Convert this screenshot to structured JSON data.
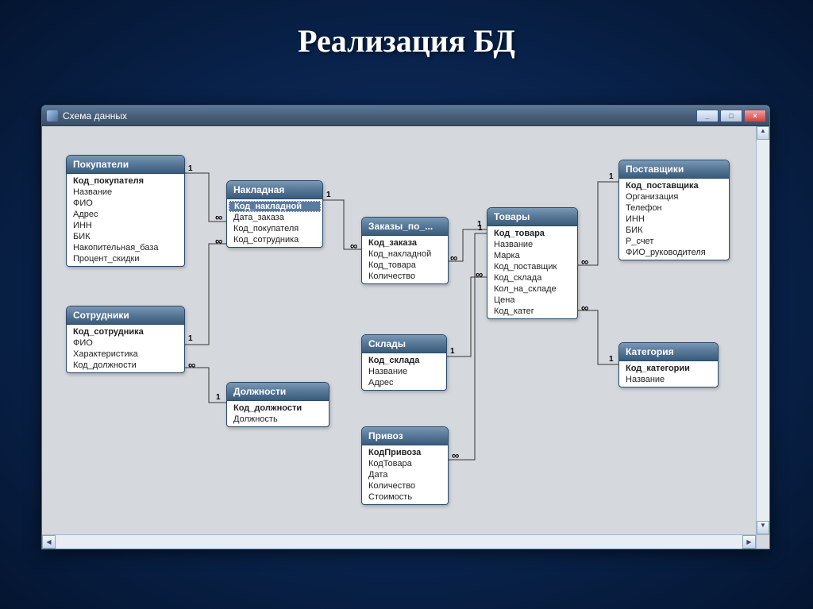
{
  "slide_title": "Реализация БД",
  "window": {
    "title": "Схема данных",
    "btn_min": "_",
    "btn_max": "□",
    "btn_close": "×"
  },
  "tables": {
    "customers": {
      "title": "Покупатели",
      "fields": [
        "Код_покупателя",
        "Название",
        "ФИО",
        "Адрес",
        "ИНН",
        "БИК",
        "Накопительная_база",
        "Процент_скидки"
      ],
      "pk_index": 0
    },
    "employees": {
      "title": "Сотрудники",
      "fields": [
        "Код_сотрудника",
        "ФИО",
        "Характеристика",
        "Код_должности"
      ],
      "pk_index": 0
    },
    "invoice": {
      "title": "Накладная",
      "fields": [
        "Код_накладной",
        "Дата_заказа",
        "Код_покупателя",
        "Код_сотрудника"
      ],
      "pk_index": 0,
      "selected": 0
    },
    "positions": {
      "title": "Должности",
      "fields": [
        "Код_должности",
        "Должность"
      ],
      "pk_index": 0
    },
    "orders": {
      "title": "Заказы_по_...",
      "fields": [
        "Код_заказа",
        "Код_накладной",
        "Код_товара",
        "Количество"
      ],
      "pk_index": 0
    },
    "warehouses": {
      "title": "Склады",
      "fields": [
        "Код_склада",
        "Название",
        "Адрес"
      ],
      "pk_index": 0
    },
    "delivery": {
      "title": "Привоз",
      "fields": [
        "КодПривоза",
        "КодТовара",
        "Дата",
        "Количество",
        "Стоимость"
      ],
      "pk_index": 0
    },
    "goods": {
      "title": "Товары",
      "fields": [
        "Код_товара",
        "Название",
        "Марка",
        "Код_поставщик",
        "Код_склада",
        "Кол_на_складе",
        "Цена",
        "Код_катег"
      ],
      "pk_index": 0
    },
    "suppliers": {
      "title": "Поставщики",
      "fields": [
        "Код_поставщика",
        "Организация",
        "Телефон",
        "ИНН",
        "БИК",
        "Р_счет",
        "ФИО_руководителя"
      ],
      "pk_index": 0
    },
    "category": {
      "title": "Категория",
      "fields": [
        "Код_категории",
        "Название"
      ],
      "pk_index": 0
    }
  },
  "relations": [
    {
      "from": "customers",
      "to": "invoice",
      "card_from": "1",
      "card_to": "∞"
    },
    {
      "from": "employees",
      "to": "invoice",
      "card_from": "1",
      "card_to": "∞"
    },
    {
      "from": "employees",
      "to": "positions",
      "card_from": "∞",
      "card_to": "1",
      "via": "Код_должности"
    },
    {
      "from": "invoice",
      "to": "orders",
      "card_from": "1",
      "card_to": "∞"
    },
    {
      "from": "goods",
      "to": "orders",
      "card_from": "1",
      "card_to": "∞"
    },
    {
      "from": "warehouses",
      "to": "goods",
      "card_from": "1",
      "card_to": "∞",
      "via": "Код_склада"
    },
    {
      "from": "goods",
      "to": "delivery",
      "card_from": "1",
      "card_to": "∞"
    },
    {
      "from": "suppliers",
      "to": "goods",
      "card_from": "1",
      "card_to": "∞",
      "via": "Код_поставщик"
    },
    {
      "from": "category",
      "to": "goods",
      "card_from": "1",
      "card_to": "∞",
      "via": "Код_катег"
    }
  ],
  "labels": {
    "one": "1",
    "many": "∞"
  }
}
